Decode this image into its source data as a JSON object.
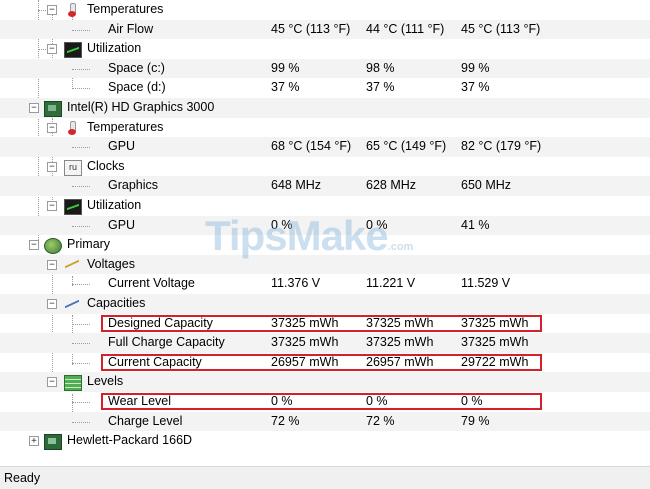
{
  "tree": {
    "temps1": {
      "label": "Temperatures",
      "icon": "thermometer-icon"
    },
    "airflow": {
      "label": "Air Flow",
      "values": [
        "45 °C  (113 °F)",
        "44 °C  (111 °F)",
        "45 °C  (113 °F)"
      ]
    },
    "util1": {
      "label": "Utilization",
      "icon": "graph-icon"
    },
    "space_c": {
      "label": "Space (c:)",
      "values": [
        "99 %",
        "98 %",
        "99 %"
      ]
    },
    "space_d": {
      "label": "Space (d:)",
      "values": [
        "37 %",
        "37 %",
        "37 %"
      ]
    },
    "gpu_device": {
      "label": "Intel(R) HD Graphics 3000",
      "icon": "chip-icon"
    },
    "temps2": {
      "label": "Temperatures",
      "icon": "thermometer-icon"
    },
    "gpu_temp": {
      "label": "GPU",
      "values": [
        "68 °C  (154 °F)",
        "65 °C  (149 °F)",
        "82 °C  (179 °F)"
      ]
    },
    "clocks": {
      "label": "Clocks",
      "icon": "clock-icon"
    },
    "graphics": {
      "label": "Graphics",
      "values": [
        "648 MHz",
        "628 MHz",
        "650 MHz"
      ]
    },
    "util2": {
      "label": "Utilization",
      "icon": "graph-icon"
    },
    "gpu_util": {
      "label": "GPU",
      "values": [
        "0 %",
        "0 %",
        "41 %"
      ]
    },
    "primary": {
      "label": "Primary",
      "icon": "battery-icon"
    },
    "voltages": {
      "label": "Voltages",
      "icon": "voltage-icon"
    },
    "current_voltage": {
      "label": "Current Voltage",
      "values": [
        "11.376 V",
        "11.221 V",
        "11.529 V"
      ]
    },
    "capacities": {
      "label": "Capacities",
      "icon": "capacity-icon"
    },
    "designed_capacity": {
      "label": "Designed Capacity",
      "values": [
        "37325 mWh",
        "37325 mWh",
        "37325 mWh"
      ]
    },
    "full_charge_capacity": {
      "label": "Full Charge Capacity",
      "values": [
        "37325 mWh",
        "37325 mWh",
        "37325 mWh"
      ]
    },
    "current_capacity": {
      "label": "Current Capacity",
      "values": [
        "26957 mWh",
        "26957 mWh",
        "29722 mWh"
      ]
    },
    "levels": {
      "label": "Levels",
      "icon": "levels-icon"
    },
    "wear_level": {
      "label": "Wear Level",
      "values": [
        "0 %",
        "0 %",
        "0 %"
      ]
    },
    "charge_level": {
      "label": "Charge Level",
      "values": [
        "72 %",
        "72 %",
        "79 %"
      ]
    },
    "hp": {
      "label": "Hewlett-Packard 166D",
      "icon": "device-icon"
    }
  },
  "watermark": {
    "main": "TipsMake",
    "suffix": ".com"
  },
  "status": {
    "text": "Ready"
  },
  "colors": {
    "highlight": "#d3202a",
    "alt_row": "#f3f3f3",
    "status_bg": "#f0f0f0"
  }
}
